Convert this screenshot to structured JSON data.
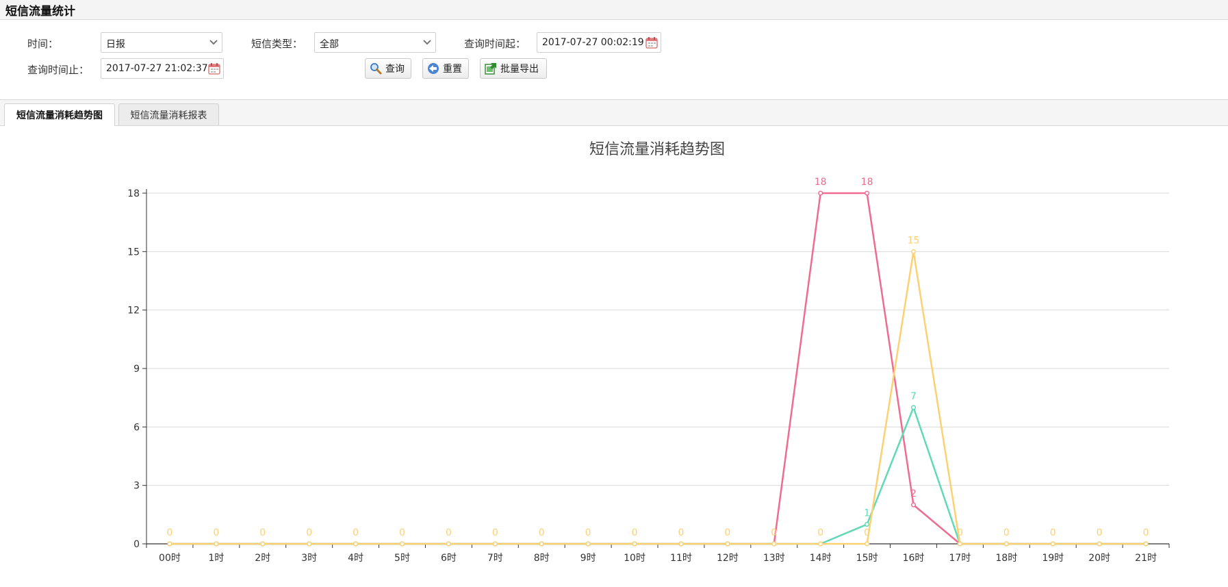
{
  "page": {
    "title": "短信流量统计"
  },
  "filters": {
    "time_label": "时间：",
    "time_value": "日报",
    "sms_type_label": "短信类型：",
    "sms_type_value": "全部",
    "start_label": "查询时间起：",
    "start_value": "2017-07-27 00:02:19",
    "end_label": "查询时间止：",
    "end_value": "2017-07-27 21:02:37"
  },
  "buttons": {
    "query": "查询",
    "reset": "重置",
    "export": "批量导出"
  },
  "tabs": [
    {
      "label": "短信流量消耗趋势图",
      "active": true
    },
    {
      "label": "短信流量消耗报表",
      "active": false
    }
  ],
  "colors": {
    "pink": "#f06b8f",
    "teal": "#5fd9b6",
    "yellow": "#fdd072",
    "grid": "#d9d9d9"
  },
  "chart_data": {
    "type": "line",
    "title": "短信流量消耗趋势图",
    "categories": [
      "00时",
      "1时",
      "2时",
      "3时",
      "4时",
      "5时",
      "6时",
      "7时",
      "8时",
      "9时",
      "10时",
      "11时",
      "12时",
      "13时",
      "14时",
      "15时",
      "16时",
      "17时",
      "18时",
      "19时",
      "20时",
      "21时"
    ],
    "ylim": [
      0,
      18
    ],
    "yticks": [
      0,
      3,
      6,
      9,
      12,
      15,
      18
    ],
    "grid": true,
    "series": [
      {
        "color": "#f06b8f",
        "values": [
          0,
          0,
          0,
          0,
          0,
          0,
          0,
          0,
          0,
          0,
          0,
          0,
          0,
          0,
          18,
          18,
          2,
          0,
          0,
          0,
          0,
          0
        ],
        "labels": [
          14,
          15,
          16
        ]
      },
      {
        "color": "#5fd9b6",
        "values": [
          0,
          0,
          0,
          0,
          0,
          0,
          0,
          0,
          0,
          0,
          0,
          0,
          0,
          0,
          0,
          1,
          7,
          0,
          0,
          0,
          0,
          0
        ],
        "labels": [
          15,
          16
        ]
      },
      {
        "color": "#fdd072",
        "values": [
          0,
          0,
          0,
          0,
          0,
          0,
          0,
          0,
          0,
          0,
          0,
          0,
          0,
          0,
          0,
          0,
          15,
          0,
          0,
          0,
          0,
          0
        ],
        "labels": [
          0,
          1,
          2,
          3,
          4,
          5,
          6,
          7,
          8,
          9,
          10,
          11,
          12,
          13,
          14,
          15,
          16,
          17,
          18,
          19,
          20,
          21
        ]
      }
    ]
  }
}
